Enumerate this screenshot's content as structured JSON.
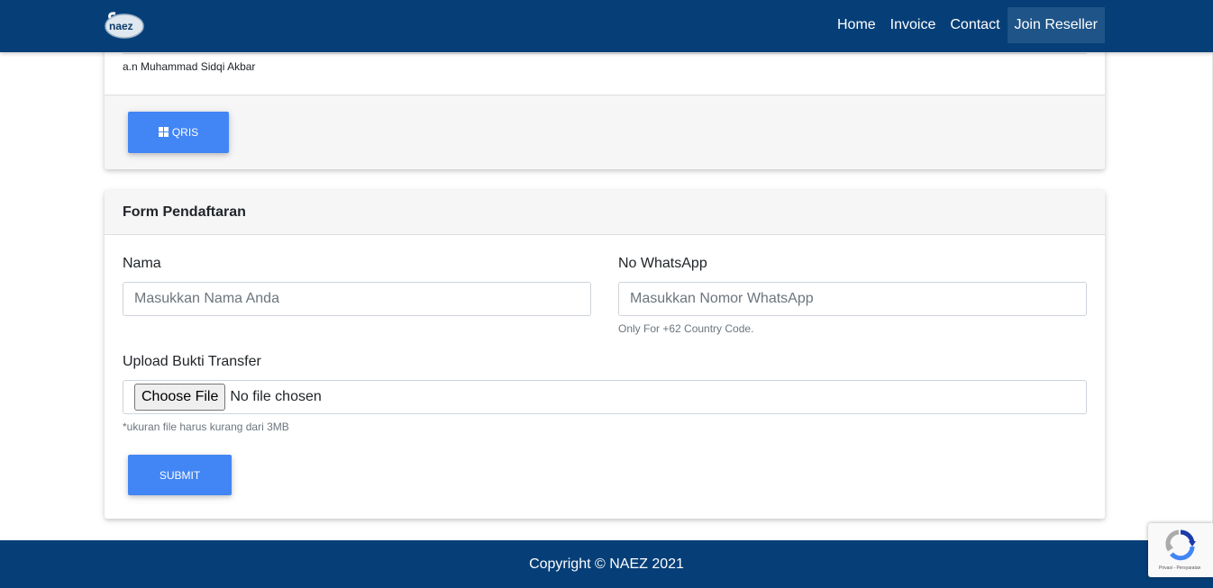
{
  "brand": {
    "logo_text": "naez",
    "accent": "#063f78",
    "button_color": "#4285f4"
  },
  "nav": {
    "items": [
      {
        "label": "Home"
      },
      {
        "label": "Invoice"
      },
      {
        "label": "Contact"
      },
      {
        "label": "Join Reseller",
        "active": true
      }
    ]
  },
  "payment": {
    "account_name": "a.n Muhammad Sidqi Akbar",
    "qris_label": "QRIS",
    "qris_icon": "grid-icon"
  },
  "form": {
    "title": "Form Pendaftaran",
    "name_label": "Nama",
    "name_placeholder": "Masukkan Nama Anda",
    "whatsapp_label": "No WhatsApp",
    "whatsapp_placeholder": "Masukkan Nomor WhatsApp",
    "whatsapp_help": "Only For +62 Country Code.",
    "upload_label": "Upload Bukti Transfer",
    "choose_file_label": "Choose File",
    "no_file_text": "No file chosen",
    "upload_help": "*ukuran file harus kurang dari 3MB",
    "submit_label": "SUBMIT"
  },
  "footer": {
    "copyright": "Copyright © NAEZ 2021"
  },
  "recaptcha": {
    "links": "Privasi - Persyaratan"
  }
}
